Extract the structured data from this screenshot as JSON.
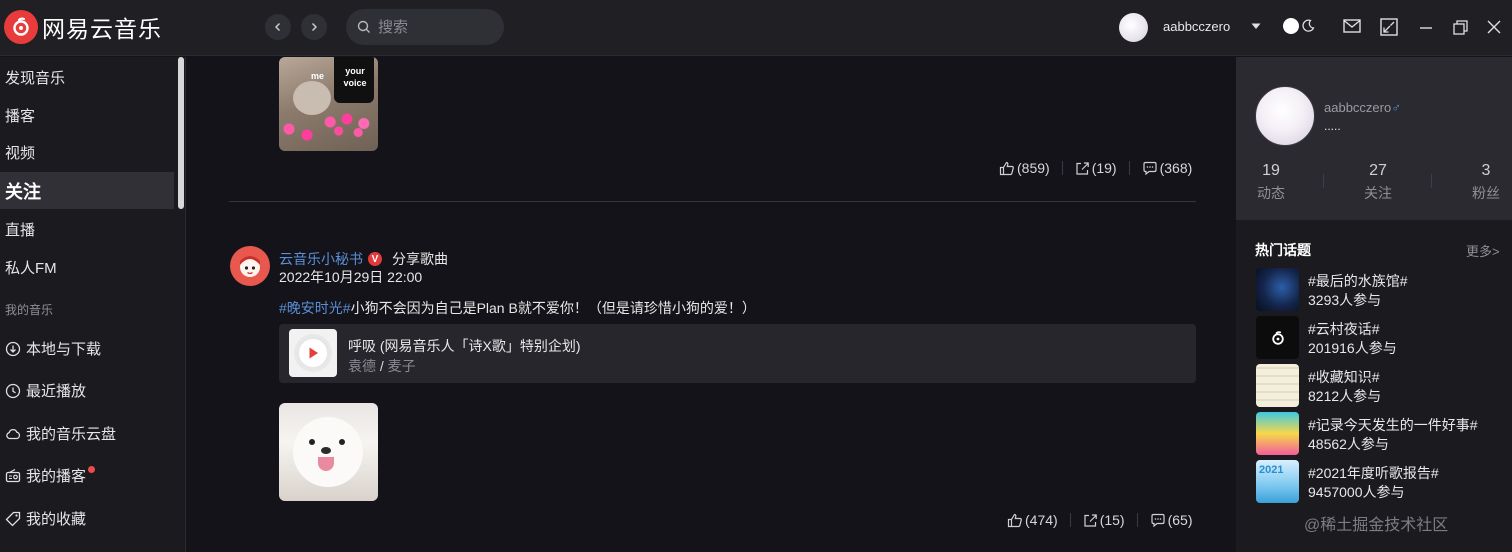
{
  "app": {
    "logo_text": "网易云音乐"
  },
  "search": {
    "placeholder": "搜索"
  },
  "user": {
    "name": "aabbcczero"
  },
  "sidebar": {
    "items": [
      {
        "label": "发现音乐"
      },
      {
        "label": "播客"
      },
      {
        "label": "视频"
      },
      {
        "label": "关注"
      },
      {
        "label": "直播"
      },
      {
        "label": "私人FM"
      }
    ],
    "section_label": "我的音乐",
    "my_music": [
      {
        "label": "本地与下载"
      },
      {
        "label": "最近播放"
      },
      {
        "label": "我的音乐云盘"
      },
      {
        "label": "我的播客"
      },
      {
        "label": "我的收藏"
      }
    ]
  },
  "feed": {
    "post1": {
      "sticker_me": "me",
      "sticker_text": "your voice",
      "likes": "(859)",
      "shares": "(19)",
      "comments": "(368)"
    },
    "post2": {
      "author": "云音乐小秘书",
      "verified_badge": "V",
      "action": "分享歌曲",
      "time": "2022年10月29日 22:00",
      "tag": "#晚安时光#",
      "text": "小狗不会因为自己是Plan B就不爱你！（但是请珍惜小狗的爱！）",
      "song_title": "呼吸 (网易音乐人「诗X歌」特别企划)",
      "song_artist_1": "袁德",
      "song_artist_sep": " / ",
      "song_artist_2": "麦子",
      "likes": "(474)",
      "shares": "(15)",
      "comments": "(65)"
    }
  },
  "profile": {
    "name": "aabbcczero",
    "gender_symbol": "♂",
    "signature": ".....",
    "stats": [
      {
        "num": "19",
        "label": "动态"
      },
      {
        "num": "27",
        "label": "关注"
      },
      {
        "num": "3",
        "label": "粉丝"
      }
    ]
  },
  "topics": {
    "title": "热门话题",
    "more": "更多>",
    "items": [
      {
        "name": "#最后的水族馆#",
        "count": "3293人参与"
      },
      {
        "name": "#云村夜话#",
        "count": "201916人参与"
      },
      {
        "name": "#收藏知识#",
        "count": "8212人参与"
      },
      {
        "name": "#记录今天发生的一件好事#",
        "count": "48562人参与"
      },
      {
        "name": "#2021年度听歌报告#",
        "count": "9457000人参与"
      }
    ],
    "report_thumb_text": "2021"
  },
  "watermark": "@稀土掘金技术社区",
  "colors": {
    "brand_red": "#e83c3c",
    "link_blue": "#5b8fd6",
    "bg": "#131319"
  }
}
